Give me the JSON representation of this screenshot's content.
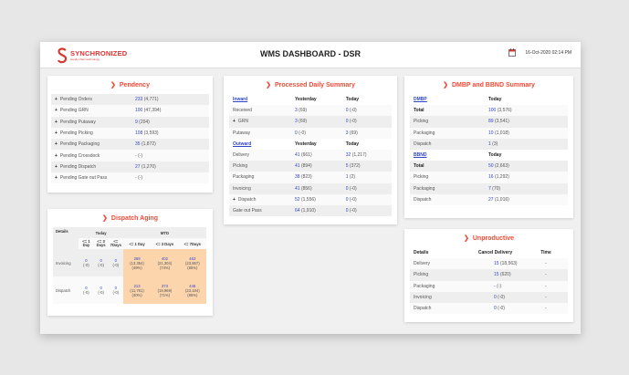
{
  "header": {
    "logo_text": "SYNCHRONIZED",
    "logo_tagline": "supply chain technology",
    "title": "WMS DASHBOARD - DSR",
    "datetime": "16-Oct-2020 02:14 PM"
  },
  "pendency": {
    "title": "Pendency",
    "rows": [
      {
        "label": "Pending Orders",
        "count": "233",
        "total": "(4,771)"
      },
      {
        "label": "Pending GRN",
        "count": "100",
        "total": "(47,394)"
      },
      {
        "label": "Pending Putaway",
        "count": "9",
        "total": "(204)"
      },
      {
        "label": "Pending Picking",
        "count": "108",
        "total": "(3,593)"
      },
      {
        "label": "Pending Packaging",
        "count": "35",
        "total": "(1,872)"
      },
      {
        "label": "Pending Crossdock",
        "count": "-",
        "total": "(-)"
      },
      {
        "label": "Pending Dispatch",
        "count": "27",
        "total": "(1,270)"
      },
      {
        "label": "Pending Gate out Pass",
        "count": "-",
        "total": "(-)"
      }
    ]
  },
  "processed": {
    "title": "Processed Daily Summary",
    "inward_label": "Inward",
    "outward_label": "Outward",
    "yesterday_label": "Yesterday",
    "today_label": "Today",
    "inward_rows": [
      {
        "label": "Received",
        "y": "3",
        "yt": "(69)",
        "t": "0",
        "tt": "(-0)"
      },
      {
        "label": "GRN",
        "y": "3",
        "yt": "(69)",
        "t": "0",
        "tt": "(-0)"
      },
      {
        "label": "Putaway",
        "y": "0",
        "yt": "(-0)",
        "t": "3",
        "tt": "(69)"
      }
    ],
    "outward_rows": [
      {
        "label": "Delivery",
        "y": "41",
        "yt": "(661)",
        "t": "32",
        "tt": "(1,217)"
      },
      {
        "label": "Picking",
        "y": "41",
        "yt": "(894)",
        "t": "5",
        "tt": "(372)"
      },
      {
        "label": "Packaging",
        "y": "38",
        "yt": "(823)",
        "t": "1",
        "tt": "(2)"
      },
      {
        "label": "Invoicing",
        "y": "41",
        "yt": "(856)",
        "t": "0",
        "tt": "(-0)"
      },
      {
        "label": "Dispatch",
        "y": "52",
        "yt": "(1,556)",
        "t": "0",
        "tt": "(-0)"
      },
      {
        "label": "Gate out Pass",
        "y": "64",
        "yt": "(1,910)",
        "t": "0",
        "tt": "(-0)"
      }
    ]
  },
  "dmbp": {
    "title": "DMBP and BBND Summary",
    "dmbp_label": "DMBP",
    "bbnd_label": "BBND",
    "today_label": "Today",
    "dmbp_rows": [
      {
        "label": "Total",
        "v": "100",
        "t": "(3,576)"
      },
      {
        "label": "Picking",
        "v": "89",
        "t": "(3,541)"
      },
      {
        "label": "Packaging",
        "v": "10",
        "t": "(1,018)"
      },
      {
        "label": "Dispatch",
        "v": "1",
        "t": "(3)"
      }
    ],
    "bbnd_rows": [
      {
        "label": "Total",
        "v": "50",
        "t": "(2,663)"
      },
      {
        "label": "Picking",
        "v": "16",
        "t": "(1,292)"
      },
      {
        "label": "Packaging",
        "v": "7",
        "t": "(70)"
      },
      {
        "label": "Dispatch",
        "v": "27",
        "t": "(1,016)"
      }
    ]
  },
  "aging": {
    "title": "Dispatch Aging",
    "details_label": "Details",
    "today_label": "Today",
    "mtd_label": "MTD",
    "today_cols": [
      "<= 1 Day",
      "<= 3 Days",
      "<= 7Days"
    ],
    "mtd_cols": [
      "<= 1 Day",
      "<= 3 Days",
      "<= 7Days"
    ],
    "rows": [
      {
        "label": "Invoicing",
        "today": [
          [
            "0",
            "(-0)"
          ],
          [
            "0",
            "(-0)"
          ],
          [
            "0",
            "(-0)"
          ]
        ],
        "mtd": [
          [
            "269",
            "(13,354)",
            "(49%)"
          ],
          [
            "402",
            "(21,304)",
            "(74%)"
          ],
          [
            "463",
            "(23,867)",
            "(85%)"
          ]
        ]
      },
      {
        "label": "Dispatch",
        "today": [
          [
            "0",
            "(-0)"
          ],
          [
            "0",
            "(-0)"
          ],
          [
            "0",
            "(-0)"
          ]
        ],
        "mtd": [
          [
            "213",
            "(11,781)",
            "(40%)"
          ],
          [
            "373",
            "(19,969)",
            "(71%)"
          ],
          [
            "446",
            "(23,184)",
            "(85%)"
          ]
        ]
      }
    ]
  },
  "unproductive": {
    "title": "Unproductive",
    "details_label": "Details",
    "cancel_label": "Cancel Delivery",
    "time_label": "Time",
    "rows": [
      {
        "label": "Delivery",
        "v": "15",
        "t": "(18,563)",
        "time": "-"
      },
      {
        "label": "Picking",
        "v": "15",
        "t": "(620)",
        "time": "-"
      },
      {
        "label": "Packaging",
        "v": "-",
        "t": "(-)",
        "time": "-"
      },
      {
        "label": "Invoicing",
        "v": "0",
        "t": "(-0)",
        "time": "-"
      },
      {
        "label": "Dispatch",
        "v": "0",
        "t": "(-0)",
        "time": "-"
      }
    ]
  },
  "colors": {
    "accent": "#ef4a36",
    "link": "#3546c8",
    "aging_highlight": "#fcd5ac"
  }
}
